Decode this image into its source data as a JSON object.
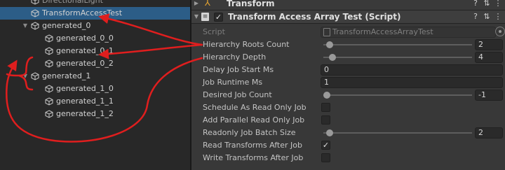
{
  "hierarchy": {
    "items": [
      {
        "label": "DirectionalLight",
        "depth": 1,
        "selected": false,
        "dim": true
      },
      {
        "label": "TransformAccessTest",
        "depth": 1,
        "selected": true
      },
      {
        "label": "generated_0",
        "depth": 1,
        "expandable": true
      },
      {
        "label": "generated_0_0",
        "depth": 2
      },
      {
        "label": "generated_0_1",
        "depth": 2
      },
      {
        "label": "generated_0_2",
        "depth": 2
      },
      {
        "label": "generated_1",
        "depth": 1,
        "expandable": true
      },
      {
        "label": "generated_1_0",
        "depth": 2
      },
      {
        "label": "generated_1_1",
        "depth": 2
      },
      {
        "label": "generated_1_2",
        "depth": 2
      }
    ]
  },
  "inspector": {
    "transform_header": {
      "title": "Transform"
    },
    "component": {
      "title": "Transform Access Array Test (Script)",
      "enabled": true,
      "script_label": "Script",
      "script_value": "TransformAccessArrayTest",
      "properties": [
        {
          "label": "Hierarchy Roots Count",
          "type": "slider",
          "value": "2",
          "fraction": 0.02
        },
        {
          "label": "Hierarchy Depth",
          "type": "slider",
          "value": "4",
          "fraction": 0.04
        },
        {
          "label": "Delay Job Start Ms",
          "type": "int",
          "value": "0"
        },
        {
          "label": "Job Runtime Ms",
          "type": "int",
          "value": "1"
        },
        {
          "label": "Desired Job Count",
          "type": "slider",
          "value": "-1",
          "fraction": 0.0
        },
        {
          "label": "Schedule As Read Only Job",
          "type": "bool",
          "checked": false
        },
        {
          "label": "Add Parallel Read Only Job",
          "type": "bool",
          "checked": false
        },
        {
          "label": "Readonly Job Batch Size",
          "type": "slider",
          "value": "2",
          "fraction": 0.02
        },
        {
          "label": "Read Transforms After Job",
          "type": "bool",
          "checked": true
        },
        {
          "label": "Write Transforms After Job",
          "type": "bool",
          "checked": false
        }
      ]
    }
  },
  "glyphs": {
    "check": "✓",
    "help": "?",
    "menu": "⋮",
    "fold_open": "▼",
    "fold_closed": "▶",
    "script": "📄"
  },
  "colors": {
    "annotation": "#e01e1e",
    "selection": "#2c5d87",
    "panel_bg": "#383838"
  }
}
